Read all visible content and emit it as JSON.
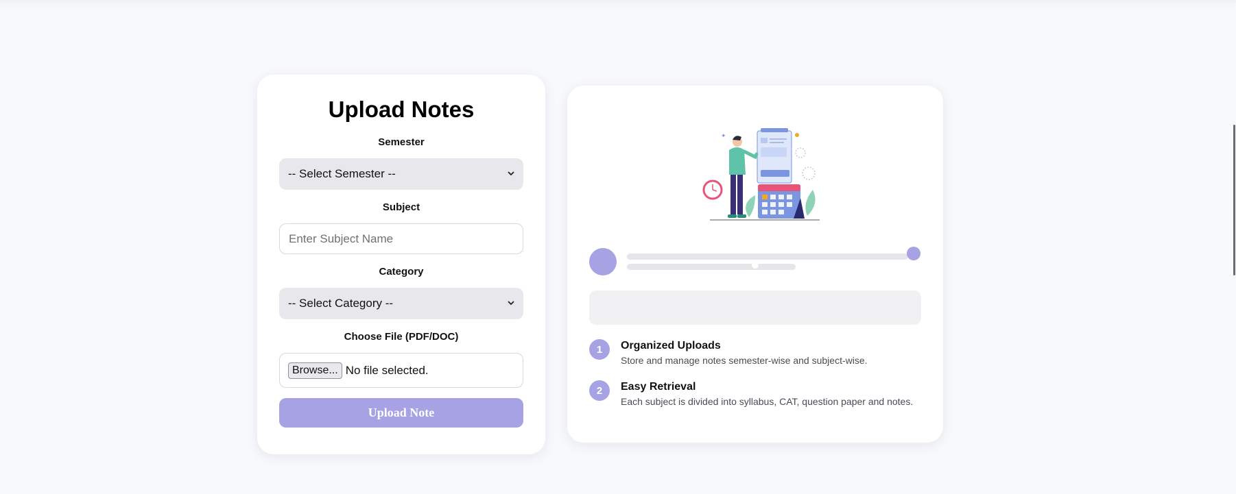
{
  "form": {
    "title": "Upload Notes",
    "semester_label": "Semester",
    "semester_selected": "-- Select Semester --",
    "subject_label": "Subject",
    "subject_placeholder": "Enter Subject Name",
    "subject_value": "",
    "category_label": "Category",
    "category_selected": "-- Select Category --",
    "file_label": "Choose File (PDF/DOC)",
    "browse_label": "Browse...",
    "file_status": "No file selected.",
    "submit_label": "Upload Note"
  },
  "info": {
    "features": [
      {
        "number": "1",
        "title": "Organized Uploads",
        "description": "Store and manage notes semester-wise and subject-wise."
      },
      {
        "number": "2",
        "title": "Easy Retrieval",
        "description": "Each subject is divided into syllabus, CAT, question paper and notes."
      }
    ]
  },
  "colors": {
    "accent": "#a6a2e3",
    "page_background": "#f8f9fc",
    "card_background": "#ffffff",
    "select_background": "#e8e8ec",
    "skeleton": "#e6e6ea"
  },
  "icons": {
    "select_arrow": "chevron-down-icon",
    "illustration": "calendar-planning-illustration"
  }
}
